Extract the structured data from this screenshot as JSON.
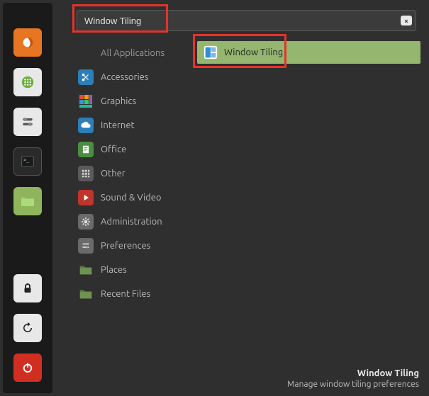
{
  "search": {
    "value": "Window Tiling",
    "clear_glyph": "×"
  },
  "categories": {
    "heading": "All Applications",
    "items": [
      {
        "label": "Accessories",
        "icon": "scissors",
        "bg": "#2c7fb8"
      },
      {
        "label": "Graphics",
        "icon": "rainbow",
        "bg": "#333333"
      },
      {
        "label": "Internet",
        "icon": "cloud",
        "bg": "#2c7fb8"
      },
      {
        "label": "Office",
        "icon": "doc",
        "bg": "#4a8f3f"
      },
      {
        "label": "Other",
        "icon": "grid",
        "bg": "#5a5a5a"
      },
      {
        "label": "Sound & Video",
        "icon": "play",
        "bg": "#c0342b"
      },
      {
        "label": "Administration",
        "icon": "gear",
        "bg": "#6a6a6a"
      },
      {
        "label": "Preferences",
        "icon": "toggles",
        "bg": "#6a6a6a"
      },
      {
        "label": "Places",
        "icon": "folder",
        "bg": "#5b7a3f"
      },
      {
        "label": "Recent Files",
        "icon": "folder",
        "bg": "#5b7a3f"
      }
    ]
  },
  "results": [
    {
      "label": "Window Tiling",
      "icon": "tiling"
    }
  ],
  "tooltip": {
    "title": "Window Tiling",
    "desc": "Manage window tiling preferences"
  },
  "launcher": {
    "items": [
      {
        "name": "firefox",
        "bg": "#e87522"
      },
      {
        "name": "apps",
        "bg": "#e8e8e8"
      },
      {
        "name": "settings",
        "bg": "#e8e8e8"
      },
      {
        "name": "terminal",
        "bg": "#2a2a2a"
      },
      {
        "name": "files",
        "bg": "#8fb55c"
      },
      {
        "name": "lock",
        "bg": "#e8e8e8"
      },
      {
        "name": "restart",
        "bg": "#e8e8e8"
      }
    ],
    "shutdown": {
      "name": "shutdown",
      "bg": "#d12e22"
    }
  }
}
